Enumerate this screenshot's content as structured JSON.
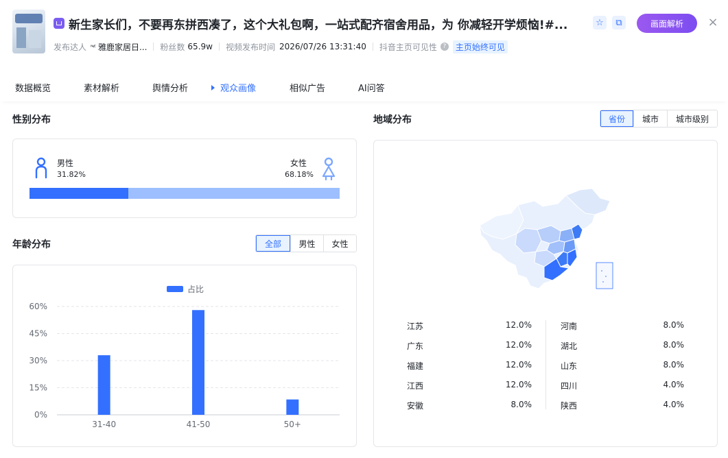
{
  "header": {
    "title": "新生家长们，不要再东拼西凑了，这个大礼包啊，一站式配齐宿舍用品，为 你减轻开学烦恼!#...",
    "parse_button": "画面解析",
    "close": "×",
    "meta": {
      "publisher_label": "发布达人",
      "publisher_mark": "ᴺᵞᴱ",
      "publisher_name": "雅鹿家居日...",
      "fans_label": "粉丝数",
      "fans_value": "65.9w",
      "publish_time_label": "视频发布时间",
      "publish_time_value": "2026/07/26 13:31:40",
      "visibility_label": "抖音主页可见性",
      "visibility_value": "主页始终可见"
    }
  },
  "tabs": [
    "数据概览",
    "素材解析",
    "舆情分析",
    "观众画像",
    "相似广告",
    "AI问答"
  ],
  "active_tab": "观众画像",
  "gender": {
    "title": "性别分布",
    "male_label": "男性",
    "male_pct": "31.82%",
    "male_share": 31.82,
    "female_label": "女性",
    "female_pct": "68.18%",
    "colors": {
      "male": "#3370ff",
      "female": "#9dbfff"
    }
  },
  "age": {
    "title": "年龄分布",
    "filters": [
      "全部",
      "男性",
      "女性"
    ],
    "active_filter": "全部",
    "legend": "占比"
  },
  "chart_data": {
    "type": "bar",
    "categories": [
      "31-40",
      "41-50",
      "50+"
    ],
    "series": [
      {
        "name": "占比",
        "values": [
          33,
          58,
          8.5
        ]
      }
    ],
    "ylim": [
      0,
      60
    ],
    "yticks": [
      "0%",
      "15%",
      "30%",
      "45%",
      "60%"
    ],
    "ytick_values": [
      0,
      15,
      30,
      45,
      60
    ],
    "color": "#3370ff",
    "grid": true,
    "legend_position": "top-center"
  },
  "region": {
    "title": "地域分布",
    "filters": [
      "省份",
      "城市",
      "城市级别"
    ],
    "active_filter": "省份",
    "left_list": [
      {
        "name": "江苏",
        "value": "12.0%"
      },
      {
        "name": "广东",
        "value": "12.0%"
      },
      {
        "name": "福建",
        "value": "12.0%"
      },
      {
        "name": "江西",
        "value": "12.0%"
      },
      {
        "name": "安徽",
        "value": "8.0%"
      }
    ],
    "right_list": [
      {
        "name": "河南",
        "value": "8.0%"
      },
      {
        "name": "湖北",
        "value": "8.0%"
      },
      {
        "name": "山东",
        "value": "8.0%"
      },
      {
        "name": "四川",
        "value": "4.0%"
      },
      {
        "name": "陕西",
        "value": "4.0%"
      }
    ]
  }
}
